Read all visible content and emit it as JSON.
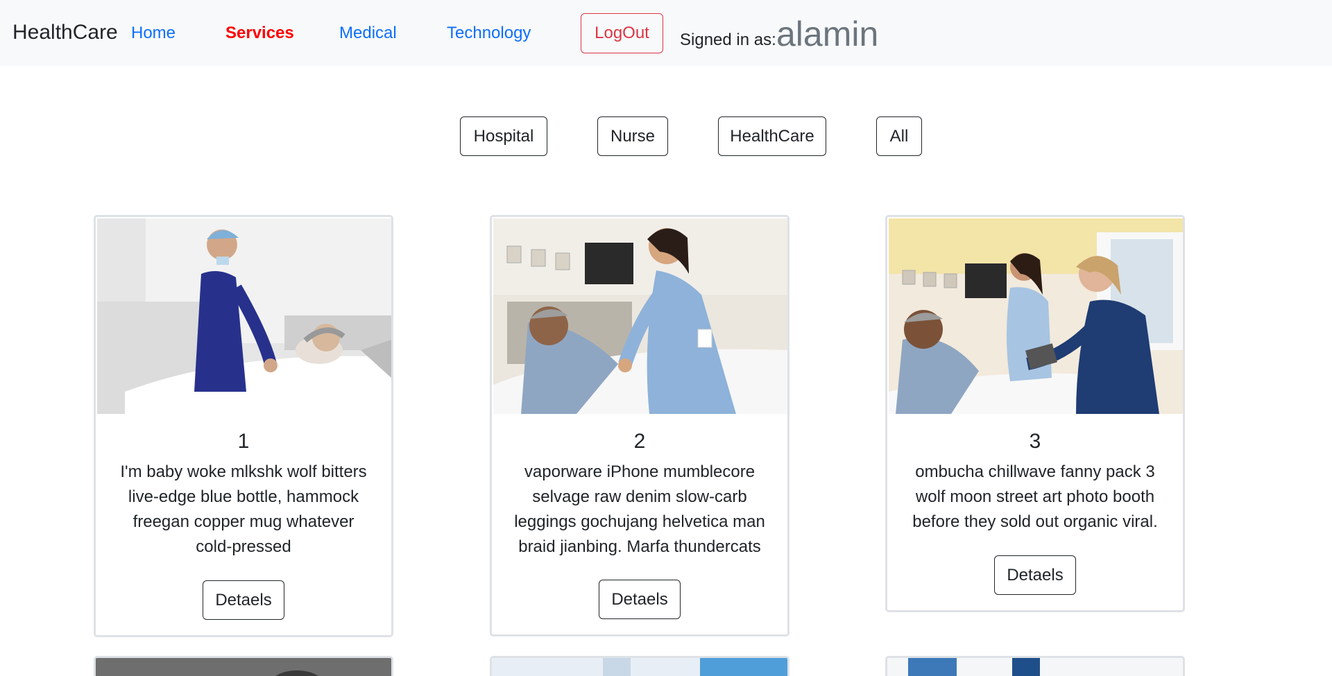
{
  "navbar": {
    "brand": "HealthCare",
    "links": [
      {
        "label": "Home"
      },
      {
        "label": "Services"
      },
      {
        "label": "Medical"
      },
      {
        "label": "Technology"
      }
    ],
    "logout_label": "LogOut",
    "signed_in_label": "Signed in as:",
    "username": "alamin"
  },
  "filters": [
    "Hospital",
    "Nurse",
    "HealthCare",
    "All"
  ],
  "cards": [
    {
      "title": "1",
      "text": "I'm baby woke mlkshk wolf bitters live-edge blue bottle, hammock freegan copper mug whatever cold-pressed",
      "button": "Detaels"
    },
    {
      "title": "2",
      "text": "vaporware iPhone mumblecore selvage raw denim slow-carb leggings gochujang helvetica man braid jianbing. Marfa thundercats",
      "button": "Detaels"
    },
    {
      "title": "3",
      "text": "ombucha chillwave fanny pack 3 wolf moon street art photo booth before they sold out organic viral.",
      "button": "Detaels"
    }
  ],
  "colors": {
    "navbar_bg": "#f8f9fa",
    "link": "#0d6efd",
    "active_link": "#ff0000",
    "logout": "#dc3545",
    "muted": "#6c757d"
  }
}
